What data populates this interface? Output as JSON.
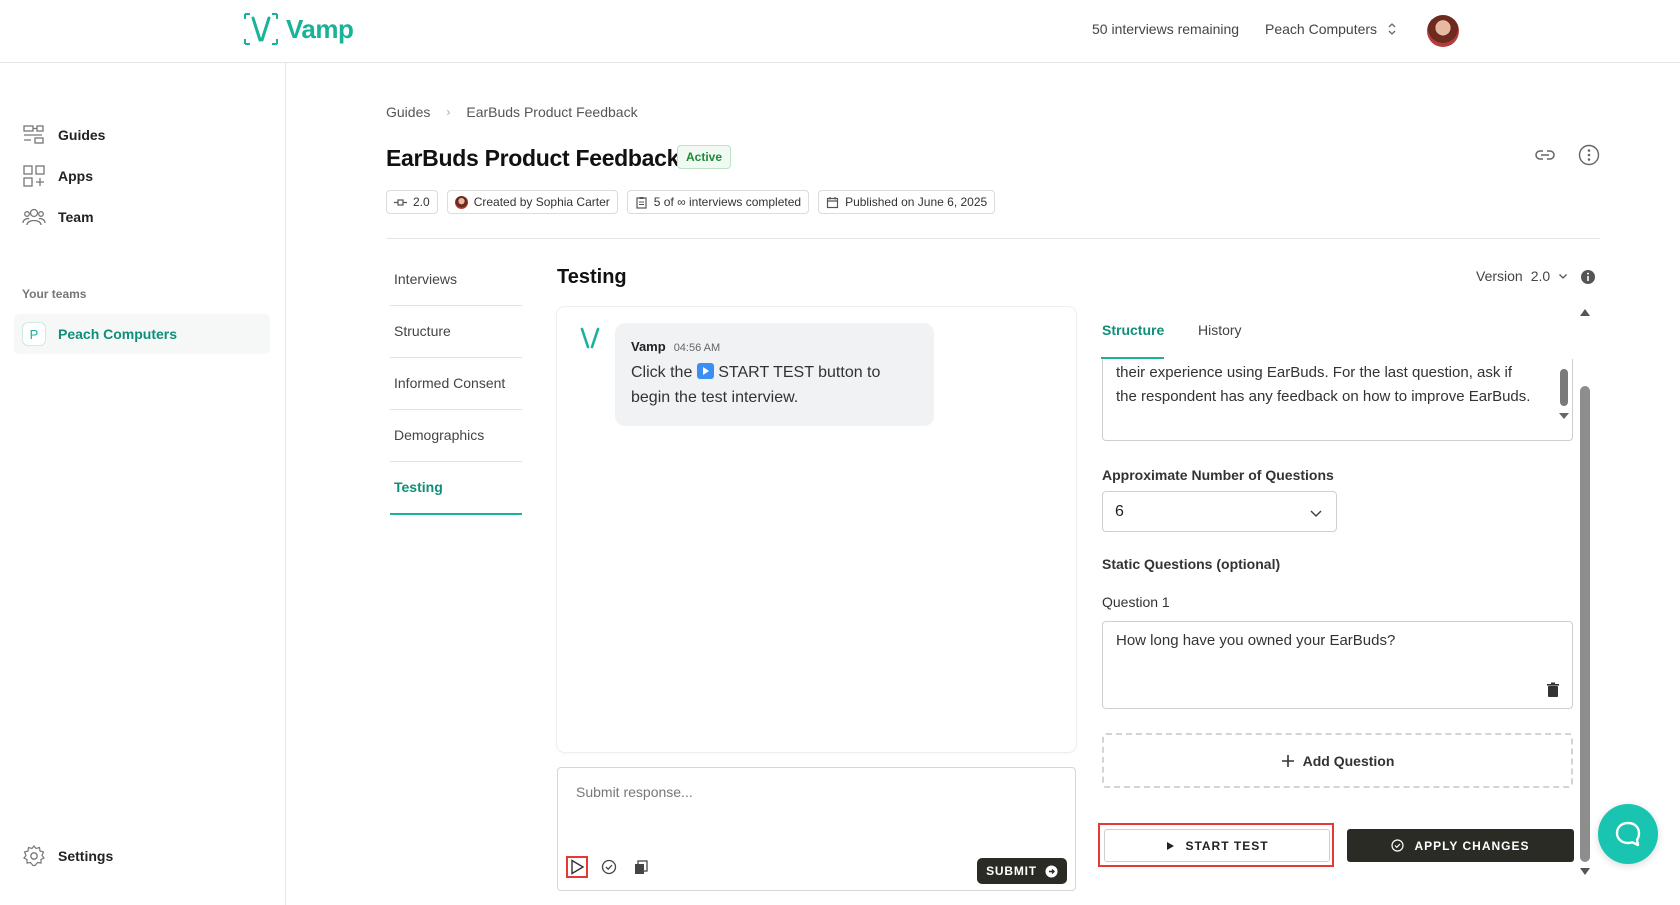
{
  "app": {
    "name": "Vamp"
  },
  "header": {
    "remaining": "50 interviews remaining",
    "org": "Peach Computers"
  },
  "sidebar": {
    "items": [
      {
        "label": "Guides",
        "icon": "guides-icon"
      },
      {
        "label": "Apps",
        "icon": "apps-icon"
      },
      {
        "label": "Team",
        "icon": "team-icon"
      }
    ],
    "teams_label": "Your teams",
    "team": {
      "initial": "P",
      "name": "Peach Computers"
    },
    "settings_label": "Settings"
  },
  "breadcrumb": {
    "root": "Guides",
    "current": "EarBuds Product Feedback"
  },
  "guide": {
    "title": "EarBuds Product Feedback",
    "status": "Active",
    "meta": {
      "version": "2.0",
      "created_by": "Created by Sophia Carter",
      "interviews": "5 of ∞ interviews completed",
      "published": "Published on June 6, 2025"
    }
  },
  "sections": [
    {
      "label": "Interviews",
      "active": false
    },
    {
      "label": "Structure",
      "active": false
    },
    {
      "label": "Informed Consent",
      "active": false
    },
    {
      "label": "Demographics",
      "active": false
    },
    {
      "label": "Testing",
      "active": true
    }
  ],
  "testing": {
    "title": "Testing",
    "version_label": "Version",
    "version_value": "2.0",
    "message": {
      "sender": "Vamp",
      "time": "04:56 AM",
      "text_before": "Click the ",
      "text_after": " START TEST button to begin the test interview."
    },
    "response_placeholder": "Submit response...",
    "submit_label": "SUBMIT"
  },
  "structure_panel": {
    "tabs": [
      "Structure",
      "History"
    ],
    "description_tail": "their experience using EarBuds. For the last question, ask if the respondent has any feedback on how to improve EarBuds.",
    "num_questions_label": "Approximate Number of Questions",
    "num_questions_value": "6",
    "static_label": "Static Questions (optional)",
    "question1_label": "Question 1",
    "question1_value": "How long have you owned your EarBuds?",
    "add_question_label": "Add Question",
    "start_test_label": "START TEST",
    "apply_label": "APPLY CHANGES"
  },
  "colors": {
    "accent": "#19b39a",
    "dark_button": "#2b2b26",
    "highlight": "#e53935"
  }
}
